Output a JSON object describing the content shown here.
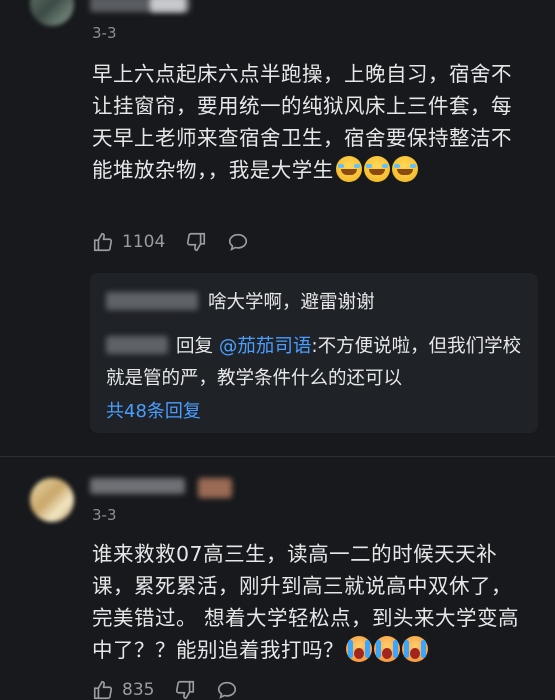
{
  "comments": [
    {
      "date": "3-3",
      "text": "早上六点起床六点半跑操，上晚自习，宿舍不让挂窗帘，要用统一的纯狱风床上三件套，每天早上老师来查宿舍卫生，宿舍要保持整洁不能堆放杂物，，我是大学生",
      "emoji_icon": "crying-laughing-emoji",
      "like_count": "1104",
      "replies": [
        {
          "text": "啥大学啊，避雷谢谢"
        },
        {
          "reply_label": "回复",
          "mention": "@茄茄司语",
          "text": ":不方便说啦，但我们学校就是管的严，教学条件什么的还可以"
        }
      ],
      "more_replies": "共48条回复"
    },
    {
      "date": "3-3",
      "text": "谁来救救07高三生，读高一二的时候天天补课，累死累活，刚升到高三就说高中双休了，完美错过。 想着大学轻松点，到头来大学变高中了？？能别追着我打吗？",
      "emoji_icon": "loudly-crying-emoji",
      "like_count": "835"
    }
  ],
  "colors": {
    "background": "#17191c",
    "link": "#4a9eff",
    "muted": "#8a8d93"
  }
}
